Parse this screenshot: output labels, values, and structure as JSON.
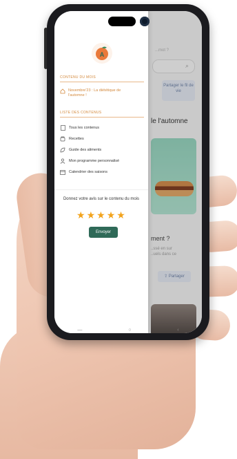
{
  "drawer": {
    "section_month": "CONTENU DU MOIS",
    "feature_text": "Novembre'23 : La diététique de l'automne !",
    "section_list": "LISTE DES CONTENUS",
    "items": [
      {
        "label": "Tous les contenus",
        "icon": "document-icon"
      },
      {
        "label": "Recettes",
        "icon": "recipe-icon"
      },
      {
        "label": "Guide des aliments",
        "icon": "leaf-icon"
      },
      {
        "label": "Mon programme personnalisé",
        "icon": "person-icon"
      },
      {
        "label": "Calendrier des saisons",
        "icon": "calendar-icon"
      }
    ],
    "rating_prompt": "Donnez votre avis sur le contenu du mois",
    "stars": [
      "★",
      "★",
      "★",
      "★",
      "★"
    ],
    "rating_value": 5,
    "send_label": "Envoyer"
  },
  "background": {
    "hint": "...mot ?",
    "share_card": "Partager le fil de vie",
    "share_icon": "share-icon",
    "heading": "le l'automne",
    "question": "ment ?",
    "text_lines": [
      "..ssé en sur",
      "..uels dans ce"
    ],
    "share_btn": "Partager"
  },
  "navbar": {
    "items": [
      "—",
      "○",
      "‹"
    ]
  },
  "colors": {
    "accent": "#d3883b",
    "primary": "#2f6a58",
    "star": "#f2a31c"
  }
}
